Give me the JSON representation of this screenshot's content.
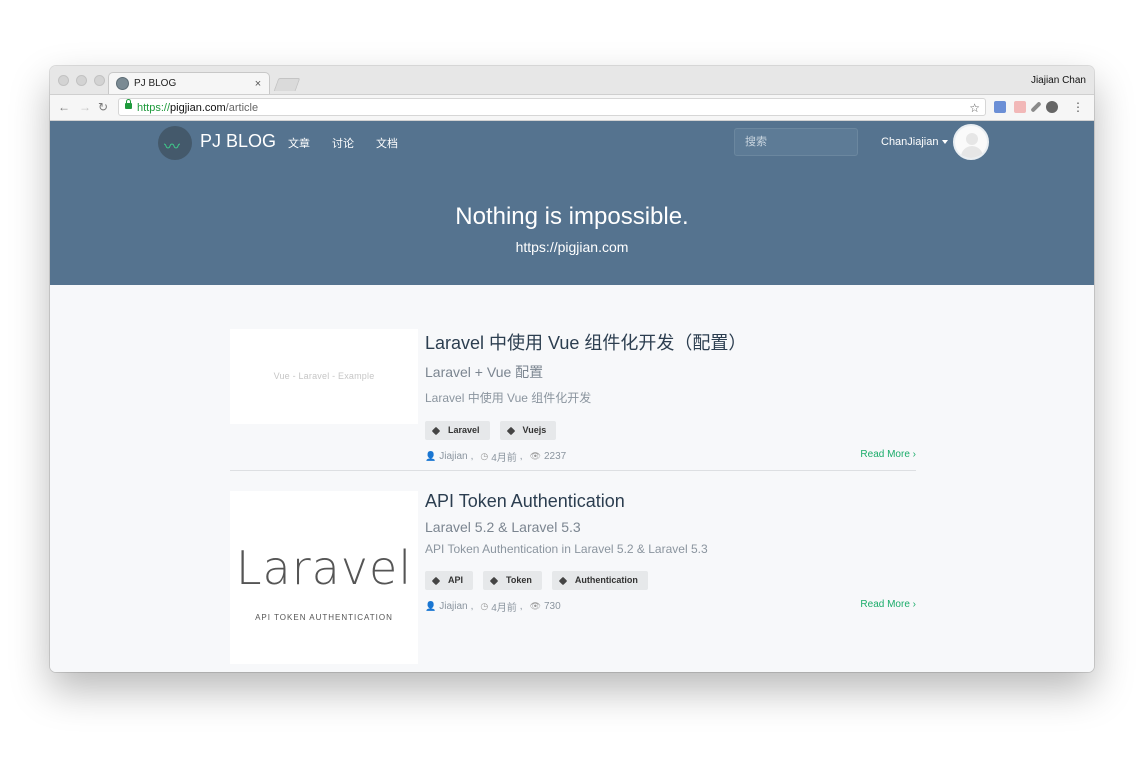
{
  "browser": {
    "tab_title": "PJ BLOG",
    "tab_close": "×",
    "profile_name": "Jiajian Chan",
    "url_scheme": "https://",
    "url_host": "pigjian.com",
    "url_path": "/article",
    "back_icon": "←",
    "forward_icon": "→",
    "reload_icon": "↻",
    "star_icon": "☆",
    "menu_icon": "⋮"
  },
  "navbar": {
    "brand": "PJ BLOG",
    "links": [
      "文章",
      "讨论",
      "文档"
    ],
    "search_placeholder": "搜索",
    "user_name": "ChanJiajian"
  },
  "hero": {
    "title": "Nothing is impossible.",
    "subtitle": "https://pigjian.com"
  },
  "articles": [
    {
      "thumb_text": "Vue - Laravel - Example",
      "title": "Laravel 中使用 Vue 组件化开发（配置）",
      "subtitle": "Laravel + Vue 配置",
      "description": "Laravel 中使用 Vue 组件化开发",
      "tags": [
        "Laravel",
        "Vuejs"
      ],
      "author": "Jiajian",
      "time": "4月前",
      "views": "2237",
      "read_more": "Read More"
    },
    {
      "thumb_text": "Laravel",
      "thumb_caption": "API TOKEN AUTHENTICATION",
      "title": "API Token Authentication",
      "subtitle": "Laravel 5.2 & Laravel 5.3",
      "description": "API Token Authentication in Laravel 5.2 & Laravel 5.3",
      "tags": [
        "API",
        "Token",
        "Authentication"
      ],
      "author": "Jiajian",
      "time": "4月前",
      "views": "730",
      "read_more": "Read More"
    }
  ],
  "meta_separator": ",",
  "icons": {
    "author": "user-icon",
    "time": "clock-icon",
    "views": "eye-icon",
    "tag": "tag-icon",
    "read_more": "chevron-right-icon"
  },
  "colors": {
    "navbar": "#55738f",
    "accent": "#1aac6a",
    "title": "#2c3e50"
  }
}
